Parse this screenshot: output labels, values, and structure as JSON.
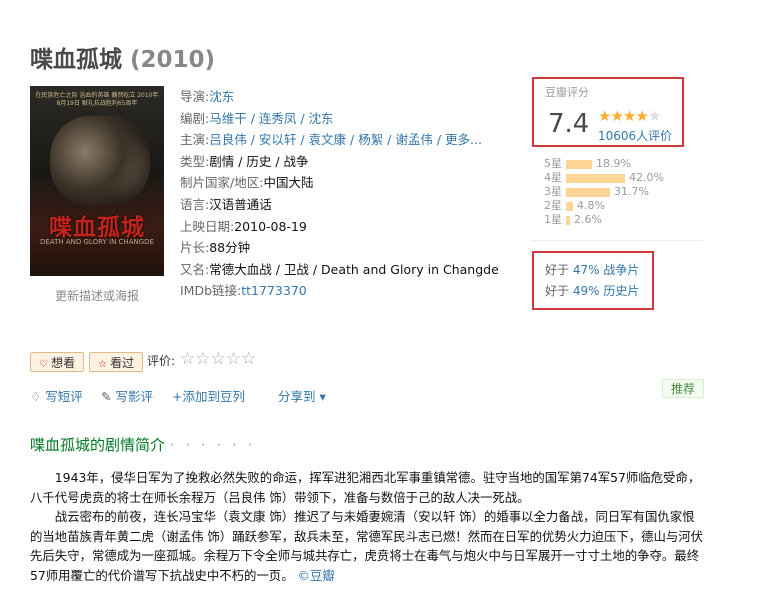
{
  "title": {
    "name": "喋血孤城",
    "year": "(2010)"
  },
  "poster": {
    "top_text": "在民族危亡之际 浴血的英雄 巍然屹立 2010年8月19日 献礼抗战胜利65周年",
    "title_text": "喋血孤城",
    "sub_text": "DEATH AND GLORY IN CHANGDE",
    "update_link": "更新描述或海报"
  },
  "info": {
    "director_label": "导演:",
    "director": "沈东",
    "writer_label": "编剧:",
    "writers": "马维干 / 连秀凤 / 沈东",
    "cast_label": "主演:",
    "cast": "吕良伟 / 安以轩 / 袁文康 / 杨絮 / 谢孟伟 / 更多...",
    "genre_label": "类型:",
    "genre": "剧情 / 历史 / 战争",
    "country_label": "制片国家/地区:",
    "country": "中国大陆",
    "language_label": "语言:",
    "language": "汉语普通话",
    "release_label": "上映日期:",
    "release": "2010-08-19",
    "runtime_label": "片长:",
    "runtime": "88分钟",
    "aka_label": "又名:",
    "aka": "常德大血战 / 卫战 / Death and Glory in Changde",
    "imdb_label": "IMDb链接:",
    "imdb": "tt1773370"
  },
  "rating": {
    "label": "豆瓣评分",
    "score": "7.4",
    "stars_value": 3.5,
    "votes": "10606人评价",
    "distribution": [
      {
        "label": "5星",
        "pct": "18.9%",
        "value": 18.9
      },
      {
        "label": "4星",
        "pct": "42.0%",
        "value": 42.0
      },
      {
        "label": "3星",
        "pct": "31.7%",
        "value": 31.7
      },
      {
        "label": "2星",
        "pct": "4.8%",
        "value": 4.8
      },
      {
        "label": "1星",
        "pct": "2.6%",
        "value": 2.6
      }
    ]
  },
  "better_than": [
    {
      "prefix": "好于 ",
      "pct": "47%",
      "category": " 战争片"
    },
    {
      "prefix": "好于 ",
      "pct": "49%",
      "category": " 历史片"
    }
  ],
  "user_actions": {
    "want": "想看",
    "seen": "看过",
    "rate_label": "评价:",
    "write_comment": "写短评",
    "write_review": "写影评",
    "add_doulist": "+添加到豆列",
    "share": "分享到 ▾",
    "recommend": "推荐"
  },
  "intro": {
    "heading": "喋血孤城的剧情简介",
    "dots": "· · · · · ·",
    "para1": "1943年，侵华日军为了挽救必然失败的命运，挥军进犯湘西北军事重镇常德。驻守当地的国军第74军57师临危受命，八千代号虎贲的将士在师长余程万（吕良伟 饰）带领下，准备与数倍于己的敌人决一死战。",
    "para2": "战云密布的前夜，连长冯宝华（袁文康 饰）推迟了与未婚妻婉清（安以轩 饰）的婚事以全力备战，同日军有国仇家恨的当地苗族青年黄二虎（谢孟伟 饰）踊跃参军，敌兵未至，常德军民斗志已燃！然而在日军的优势火力迫压下，德山与河伏先后失守，常德成为一座孤城。余程万下令全师与城共存亡，虎贲将士在毒气与炮火中与日军展开一寸寸土地的争夺。最终57师用覆亡的代价谱写下抗战史中不朽的一页。",
    "source": "©豆瓣"
  },
  "colors": {
    "link": "#3377aa",
    "highlight_border": "#d0393b",
    "star": "#ffac2d",
    "bar": "#ffd596",
    "heading_green": "#007722"
  }
}
